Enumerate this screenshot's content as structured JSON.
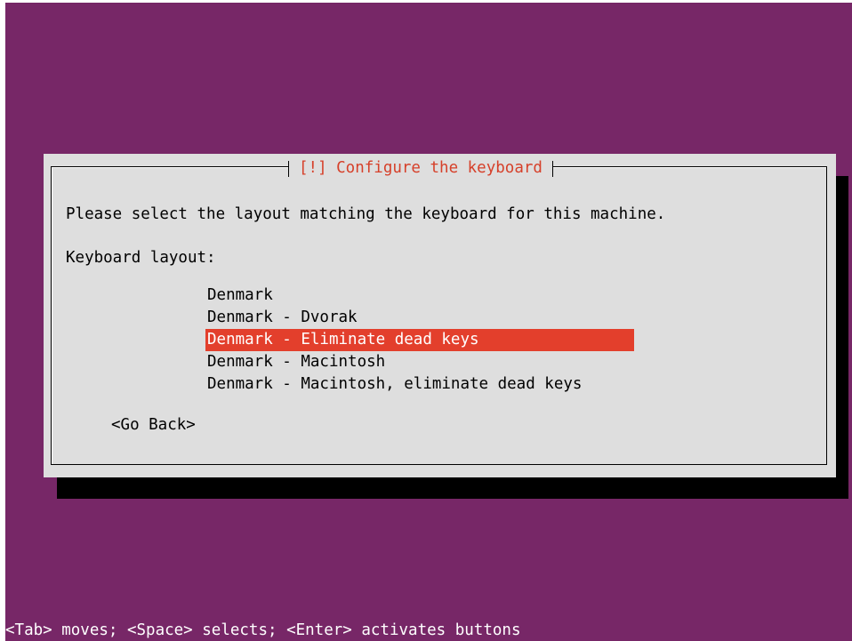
{
  "dialog": {
    "title": "[!] Configure the keyboard",
    "prompt": "Please select the layout matching the keyboard for this machine.",
    "field_label": "Keyboard layout:",
    "layouts": [
      "Denmark",
      "Denmark - Dvorak",
      "Denmark - Eliminate dead keys",
      "Denmark - Macintosh",
      "Denmark - Macintosh, eliminate dead keys"
    ],
    "selected_index": 2,
    "back_label": "<Go Back>"
  },
  "footer": {
    "help_text": "<Tab> moves; <Space> selects; <Enter> activates buttons"
  },
  "colors": {
    "background": "#772767",
    "dialog": "#dedede",
    "selection": "#e33f2c",
    "title": "#d6402a"
  }
}
